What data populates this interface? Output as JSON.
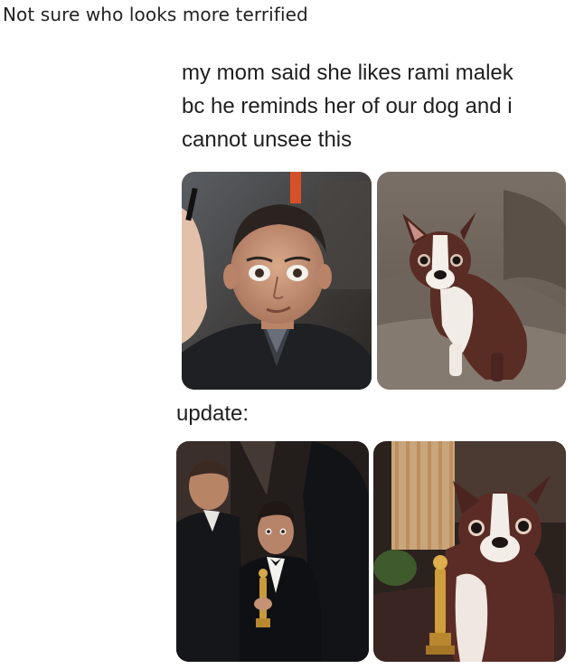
{
  "post": {
    "caption": "Not sure who looks more terrified"
  },
  "tweet": {
    "lines": [
      "my mom said she likes rami malek",
      "bc he reminds her of our dog and i",
      "cannot unsee this"
    ],
    "update_label": "update:"
  }
}
